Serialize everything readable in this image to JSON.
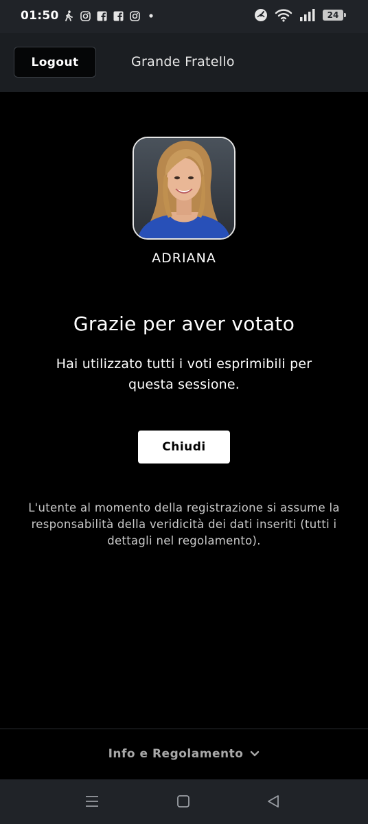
{
  "status_bar": {
    "time": "01:50",
    "left_icons": [
      "walking-icon",
      "instagram-icon",
      "facebook-icon",
      "facebook-icon",
      "instagram-icon",
      "dot-icon"
    ],
    "right_icons": [
      "data-saver-icon",
      "wifi-icon",
      "signal-icon"
    ],
    "battery_level": "24"
  },
  "header": {
    "logout_label": "Logout",
    "title": "Grande Fratello"
  },
  "contestant": {
    "name": "ADRIANA"
  },
  "content": {
    "thanks_title": "Grazie per aver votato",
    "thanks_message": "Hai utilizzato tutti i voti esprimibili per questa sessione.",
    "close_label": "Chiudi",
    "disclaimer": "L'utente al momento della registrazione si assume la responsabilità della veridicità dei dati inseriti (tutti i dettagli nel regolamento)."
  },
  "footer": {
    "link_label": "Info e Regolamento",
    "link_icon": "chevron-down-icon"
  },
  "nav_bar": {
    "icons": [
      "menu-icon",
      "home-icon",
      "back-icon"
    ]
  },
  "colors": {
    "background": "#000000",
    "header_bg": "#1b1e22",
    "system_bar_bg": "#202328",
    "button_bg": "#ffffff",
    "muted_text": "#a8a8a8"
  }
}
